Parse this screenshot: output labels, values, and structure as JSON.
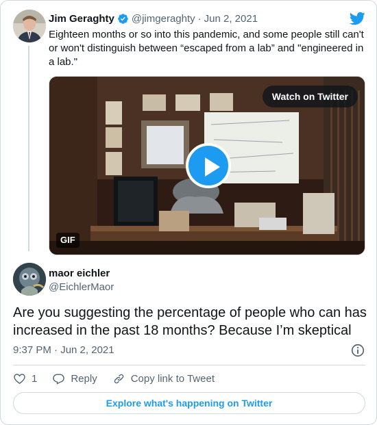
{
  "parent_tweet": {
    "author_name": "Jim Geraghty",
    "handle": "@jimgeraghty",
    "separator": "·",
    "date": "Jun 2, 2021",
    "text": "Eighteen months or so into this pandemic, and some people still can't or won't distinguish between “escaped from a lab” and \"engineered in a lab.\"",
    "media": {
      "watch_label": "Watch on Twitter",
      "badge": "GIF"
    }
  },
  "reply_tweet": {
    "author_name": "maor eichler",
    "handle": "@EichlerMaor",
    "text": "Are you suggesting the percentage of people who can has increased in the past 18 months? Because I’m skeptical",
    "timestamp": "9:37 PM · Jun 2, 2021"
  },
  "actions": {
    "like_count": "1",
    "reply_label": "Reply",
    "copy_link_label": "Copy link to Tweet"
  },
  "footer": {
    "explore_label": "Explore what's happening on Twitter"
  },
  "colors": {
    "accent": "#1d9bf0",
    "text_primary": "#0f1419",
    "text_secondary": "#536471",
    "border": "#cfd9de"
  },
  "icons": [
    "verified-badge-icon",
    "twitter-bird-icon",
    "play-icon",
    "info-icon",
    "heart-icon",
    "reply-icon",
    "link-icon"
  ]
}
